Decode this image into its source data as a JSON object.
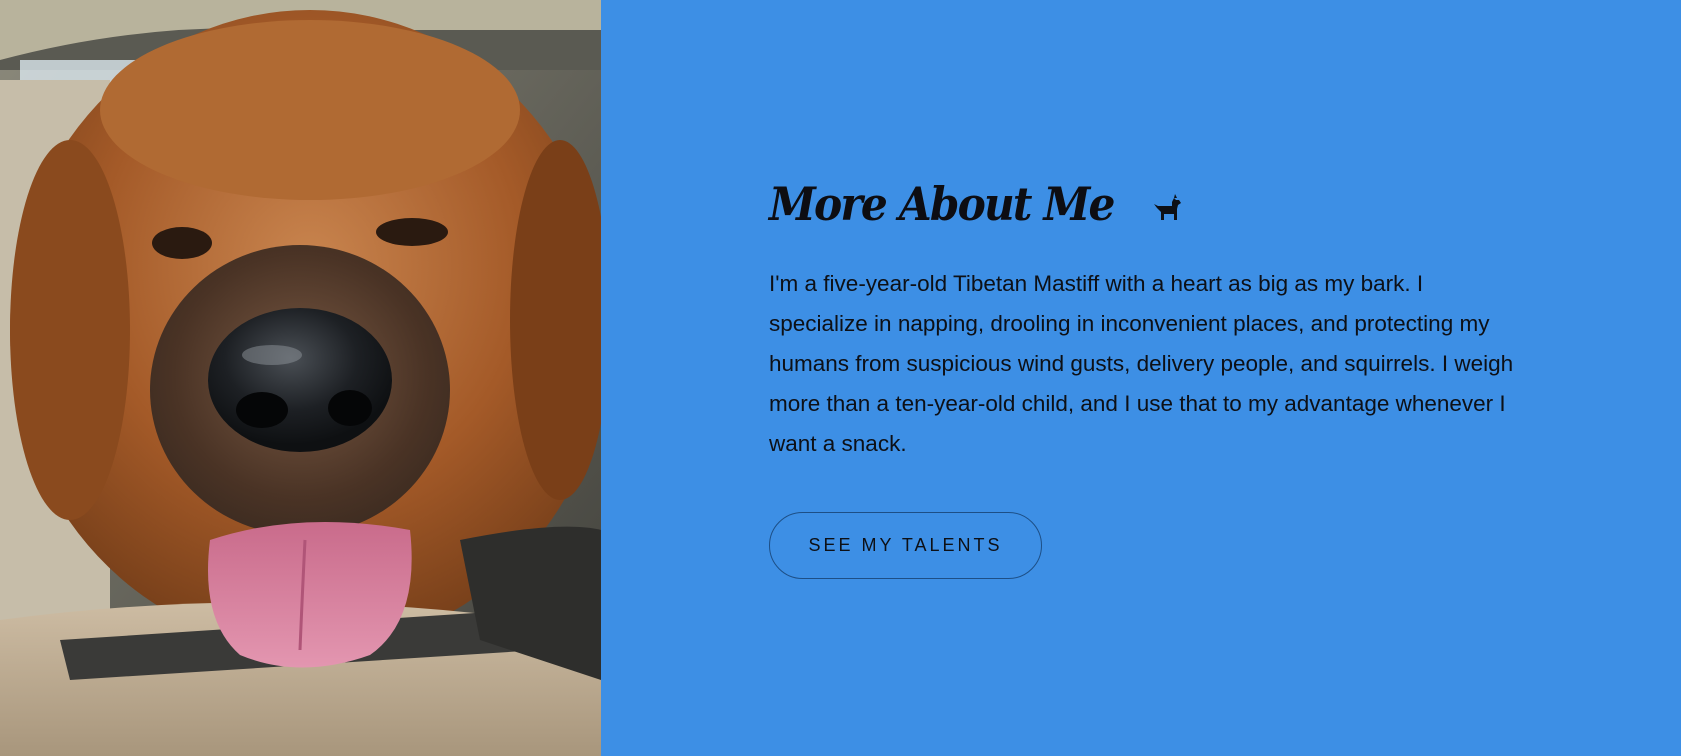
{
  "theme": {
    "panel_bg": "#3d8fe5",
    "text_color": "#0d1016",
    "button_border": "#1d4f86"
  },
  "photo": {
    "subject": "Tibetan Mastiff resting chin on car seat armrest"
  },
  "about": {
    "heading": "More About Me",
    "heading_icon": "dog-icon",
    "bio": "I'm a five-year-old Tibetan Mastiff with a heart as big as my bark. I specialize in napping, drooling in inconvenient places, and protecting my humans from suspicious wind gusts, delivery people, and squirrels. I weigh more than a ten-year-old child, and I use that to my advantage whenever I want a snack.",
    "cta_label": "SEE MY TALENTS"
  }
}
